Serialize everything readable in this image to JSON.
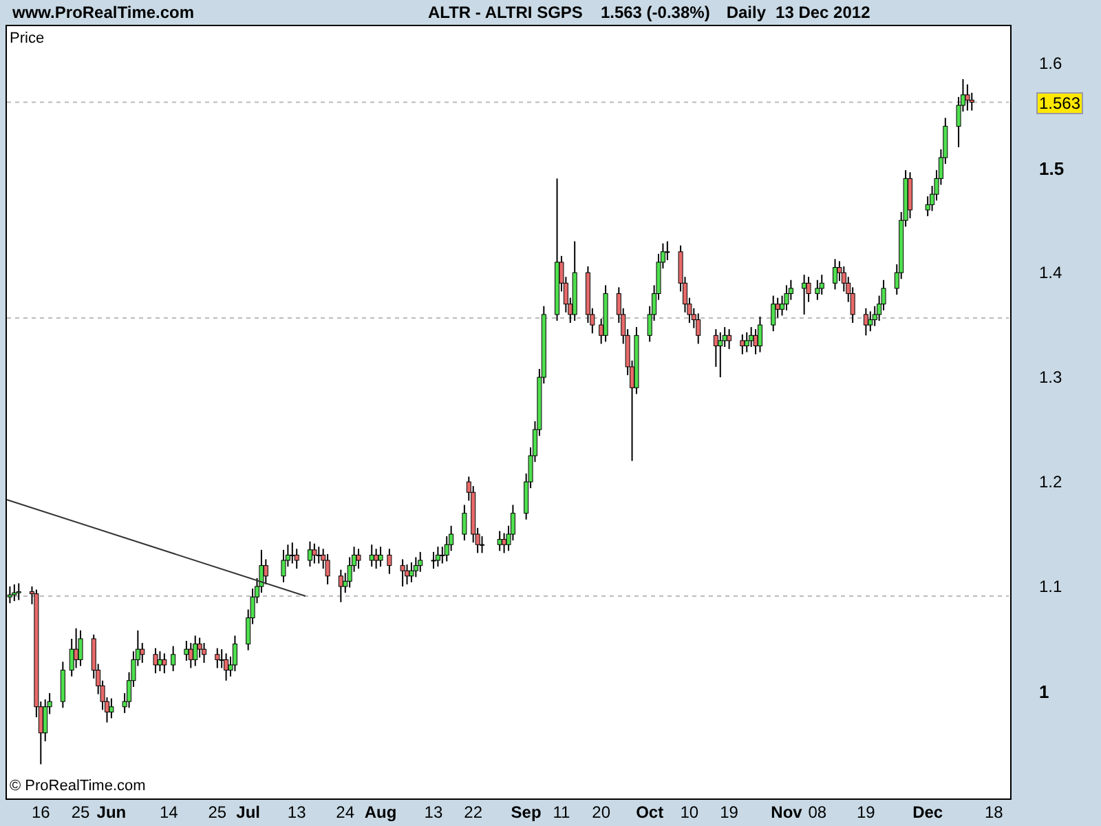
{
  "header": {
    "site": "www.ProRealTime.com",
    "instrument": "ALTR - ALTRI SGPS",
    "quote": "1.563 (-0.38%)",
    "period": "Daily",
    "date": "13 Dec 2012"
  },
  "chart": {
    "panel_label": "Price",
    "copyright": "© ProRealTime.com",
    "last_price": "1.563",
    "chart_data": {
      "type": "candlestick",
      "xlim": [
        "2012-05-08",
        "2012-12-22"
      ],
      "ylim": [
        0.896,
        1.637
      ],
      "yticks": [
        {
          "value": 1.6,
          "label": "1.6"
        },
        {
          "value": 1.5,
          "label": "1.5"
        },
        {
          "value": 1.4,
          "label": "1.4"
        },
        {
          "value": 1.3,
          "label": "1.3"
        },
        {
          "value": 1.2,
          "label": "1.2"
        },
        {
          "value": 1.1,
          "label": "1.1"
        },
        {
          "value": 1,
          "label": "1"
        }
      ],
      "xticks": [
        {
          "value": "2012-05-16",
          "label": "16"
        },
        {
          "value": "2012-05-25",
          "label": "25"
        },
        {
          "value": "2012-06-01",
          "label": "Jun"
        },
        {
          "value": "2012-06-14",
          "label": "14"
        },
        {
          "value": "2012-06-25",
          "label": "25"
        },
        {
          "value": "2012-07-02",
          "label": "Jul"
        },
        {
          "value": "2012-07-13",
          "label": "13"
        },
        {
          "value": "2012-07-24",
          "label": "24"
        },
        {
          "value": "2012-08-01",
          "label": "Aug"
        },
        {
          "value": "2012-08-13",
          "label": "13"
        },
        {
          "value": "2012-08-22",
          "label": "22"
        },
        {
          "value": "2012-09-03",
          "label": "Sep"
        },
        {
          "value": "2012-09-11",
          "label": "11"
        },
        {
          "value": "2012-09-20",
          "label": "20"
        },
        {
          "value": "2012-10-01",
          "label": "Oct"
        },
        {
          "value": "2012-10-10",
          "label": "10"
        },
        {
          "value": "2012-10-19",
          "label": "19"
        },
        {
          "value": "2012-11-01",
          "label": "Nov"
        },
        {
          "value": "2012-11-08",
          "label": "08"
        },
        {
          "value": "2012-11-19",
          "label": "19"
        },
        {
          "value": "2012-12-03",
          "label": "Dec"
        },
        {
          "value": "2012-12-18",
          "label": "18"
        }
      ],
      "x": [
        "2012-05-09",
        "2012-05-10",
        "2012-05-11",
        "2012-05-14",
        "2012-05-15",
        "2012-05-16",
        "2012-05-17",
        "2012-05-18",
        "2012-05-21",
        "2012-05-23",
        "2012-05-24",
        "2012-05-25",
        "2012-05-28",
        "2012-05-29",
        "2012-05-30",
        "2012-05-31",
        "2012-06-01",
        "2012-06-04",
        "2012-06-05",
        "2012-06-06",
        "2012-06-07",
        "2012-06-08",
        "2012-06-11",
        "2012-06-12",
        "2012-06-13",
        "2012-06-15",
        "2012-06-18",
        "2012-06-19",
        "2012-06-20",
        "2012-06-21",
        "2012-06-22",
        "2012-06-25",
        "2012-06-26",
        "2012-06-27",
        "2012-06-28",
        "2012-06-29",
        "2012-07-02",
        "2012-07-03",
        "2012-07-04",
        "2012-07-05",
        "2012-07-06",
        "2012-07-10",
        "2012-07-11",
        "2012-07-12",
        "2012-07-13",
        "2012-07-16",
        "2012-07-17",
        "2012-07-18",
        "2012-07-19",
        "2012-07-20",
        "2012-07-23",
        "2012-07-24",
        "2012-07-25",
        "2012-07-26",
        "2012-07-27",
        "2012-07-30",
        "2012-07-31",
        "2012-08-01",
        "2012-08-03",
        "2012-08-06",
        "2012-08-07",
        "2012-08-08",
        "2012-08-09",
        "2012-08-10",
        "2012-08-13",
        "2012-08-14",
        "2012-08-15",
        "2012-08-16",
        "2012-08-17",
        "2012-08-20",
        "2012-08-21",
        "2012-08-22",
        "2012-08-23",
        "2012-08-24",
        "2012-08-28",
        "2012-08-29",
        "2012-08-30",
        "2012-08-31",
        "2012-09-03",
        "2012-09-04",
        "2012-09-05",
        "2012-09-06",
        "2012-09-07",
        "2012-09-10",
        "2012-09-11",
        "2012-09-12",
        "2012-09-13",
        "2012-09-14",
        "2012-09-17",
        "2012-09-18",
        "2012-09-20",
        "2012-09-21",
        "2012-09-24",
        "2012-09-25",
        "2012-09-26",
        "2012-09-27",
        "2012-09-28",
        "2012-10-01",
        "2012-10-02",
        "2012-10-03",
        "2012-10-04",
        "2012-10-05",
        "2012-10-08",
        "2012-10-09",
        "2012-10-10",
        "2012-10-11",
        "2012-10-12",
        "2012-10-16",
        "2012-10-17",
        "2012-10-18",
        "2012-10-19",
        "2012-10-22",
        "2012-10-23",
        "2012-10-24",
        "2012-10-25",
        "2012-10-26",
        "2012-10-29",
        "2012-10-30",
        "2012-10-31",
        "2012-11-01",
        "2012-11-02",
        "2012-11-05",
        "2012-11-06",
        "2012-11-08",
        "2012-11-09",
        "2012-11-12",
        "2012-11-13",
        "2012-11-14",
        "2012-11-15",
        "2012-11-16",
        "2012-11-19",
        "2012-11-20",
        "2012-11-21",
        "2012-11-22",
        "2012-11-23",
        "2012-11-26",
        "2012-11-27",
        "2012-11-28",
        "2012-11-29",
        "2012-12-03",
        "2012-12-04",
        "2012-12-05",
        "2012-12-06",
        "2012-12-07",
        "2012-12-10",
        "2012-12-11",
        "2012-12-12",
        "2012-12-13"
      ],
      "ohlc": [
        [
          1.09,
          1.1,
          1.084,
          1.092
        ],
        [
          1.092,
          1.102,
          1.086,
          1.094
        ],
        [
          1.094,
          1.103,
          1.087,
          1.095
        ],
        [
          1.095,
          1.1,
          1.083,
          1.093
        ],
        [
          1.093,
          1.097,
          0.975,
          0.985
        ],
        [
          0.985,
          0.99,
          0.93,
          0.96
        ],
        [
          0.96,
          0.992,
          0.952,
          0.985
        ],
        [
          0.985,
          0.998,
          0.978,
          0.99
        ],
        [
          0.99,
          1.028,
          0.984,
          1.02
        ],
        [
          1.02,
          1.05,
          1.014,
          1.04
        ],
        [
          1.04,
          1.06,
          1.022,
          1.03
        ],
        [
          1.03,
          1.058,
          1.024,
          1.05
        ],
        [
          1.05,
          1.054,
          1.012,
          1.02
        ],
        [
          1.02,
          1.026,
          0.997,
          1.005
        ],
        [
          1.005,
          1.01,
          0.982,
          0.99
        ],
        [
          0.99,
          0.994,
          0.97,
          0.98
        ],
        [
          0.98,
          0.993,
          0.974,
          0.985
        ],
        [
          0.985,
          0.998,
          0.979,
          0.99
        ],
        [
          0.99,
          1.018,
          0.984,
          1.01
        ],
        [
          1.01,
          1.038,
          1.004,
          1.03
        ],
        [
          1.03,
          1.058,
          1.024,
          1.04
        ],
        [
          1.04,
          1.046,
          1.027,
          1.035
        ],
        [
          1.035,
          1.041,
          1.017,
          1.025
        ],
        [
          1.025,
          1.038,
          1.019,
          1.03
        ],
        [
          1.03,
          1.036,
          1.017,
          1.025
        ],
        [
          1.025,
          1.043,
          1.019,
          1.035
        ],
        [
          1.035,
          1.048,
          1.029,
          1.04
        ],
        [
          1.04,
          1.046,
          1.022,
          1.03
        ],
        [
          1.03,
          1.053,
          1.024,
          1.045
        ],
        [
          1.045,
          1.051,
          1.032,
          1.04
        ],
        [
          1.04,
          1.046,
          1.027,
          1.035
        ],
        [
          1.035,
          1.041,
          1.022,
          1.03
        ],
        [
          1.03,
          1.04,
          1.022,
          1.03
        ],
        [
          1.03,
          1.036,
          1.01,
          1.02
        ],
        [
          1.02,
          1.033,
          1.014,
          1.025
        ],
        [
          1.025,
          1.053,
          1.019,
          1.045
        ],
        [
          1.045,
          1.078,
          1.039,
          1.07
        ],
        [
          1.07,
          1.098,
          1.064,
          1.09
        ],
        [
          1.09,
          1.108,
          1.084,
          1.1
        ],
        [
          1.1,
          1.135,
          1.094,
          1.12
        ],
        [
          1.12,
          1.126,
          1.102,
          1.11
        ],
        [
          1.11,
          1.135,
          1.104,
          1.125
        ],
        [
          1.125,
          1.14,
          1.119,
          1.13
        ],
        [
          1.13,
          1.142,
          1.122,
          1.13
        ],
        [
          1.13,
          1.136,
          1.117,
          1.125
        ],
        [
          1.125,
          1.143,
          1.119,
          1.135
        ],
        [
          1.135,
          1.141,
          1.122,
          1.13
        ],
        [
          1.13,
          1.138,
          1.122,
          1.13
        ],
        [
          1.13,
          1.136,
          1.117,
          1.125
        ],
        [
          1.125,
          1.131,
          1.102,
          1.11
        ],
        [
          1.11,
          1.116,
          1.085,
          1.1
        ],
        [
          1.1,
          1.113,
          1.094,
          1.105
        ],
        [
          1.105,
          1.128,
          1.099,
          1.12
        ],
        [
          1.12,
          1.138,
          1.114,
          1.13
        ],
        [
          1.13,
          1.136,
          1.117,
          1.125
        ],
        [
          1.125,
          1.14,
          1.119,
          1.13
        ],
        [
          1.13,
          1.136,
          1.117,
          1.125
        ],
        [
          1.125,
          1.138,
          1.119,
          1.13
        ],
        [
          1.13,
          1.136,
          1.112,
          1.12
        ],
        [
          1.12,
          1.126,
          1.1,
          1.115
        ],
        [
          1.115,
          1.121,
          1.102,
          1.11
        ],
        [
          1.11,
          1.123,
          1.104,
          1.115
        ],
        [
          1.115,
          1.128,
          1.109,
          1.12
        ],
        [
          1.12,
          1.133,
          1.114,
          1.125
        ],
        [
          1.125,
          1.133,
          1.117,
          1.125
        ],
        [
          1.125,
          1.138,
          1.119,
          1.13
        ],
        [
          1.13,
          1.138,
          1.122,
          1.13
        ],
        [
          1.13,
          1.148,
          1.124,
          1.14
        ],
        [
          1.14,
          1.158,
          1.134,
          1.15
        ],
        [
          1.15,
          1.178,
          1.144,
          1.17
        ],
        [
          1.2,
          1.205,
          1.182,
          1.19
        ],
        [
          1.19,
          1.196,
          1.142,
          1.15
        ],
        [
          1.15,
          1.156,
          1.132,
          1.14
        ],
        [
          1.14,
          1.148,
          1.132,
          1.14
        ],
        [
          1.14,
          1.153,
          1.134,
          1.145
        ],
        [
          1.145,
          1.151,
          1.132,
          1.14
        ],
        [
          1.14,
          1.158,
          1.134,
          1.15
        ],
        [
          1.15,
          1.178,
          1.144,
          1.17
        ],
        [
          1.17,
          1.208,
          1.164,
          1.2
        ],
        [
          1.2,
          1.233,
          1.194,
          1.225
        ],
        [
          1.225,
          1.258,
          1.219,
          1.25
        ],
        [
          1.25,
          1.308,
          1.244,
          1.3
        ],
        [
          1.3,
          1.368,
          1.294,
          1.36
        ],
        [
          1.36,
          1.49,
          1.354,
          1.41
        ],
        [
          1.41,
          1.416,
          1.382,
          1.39
        ],
        [
          1.39,
          1.396,
          1.362,
          1.37
        ],
        [
          1.37,
          1.376,
          1.352,
          1.36
        ],
        [
          1.36,
          1.43,
          1.354,
          1.4
        ],
        [
          1.4,
          1.406,
          1.352,
          1.36
        ],
        [
          1.36,
          1.366,
          1.342,
          1.35
        ],
        [
          1.35,
          1.356,
          1.332,
          1.34
        ],
        [
          1.34,
          1.388,
          1.334,
          1.38
        ],
        [
          1.38,
          1.386,
          1.352,
          1.36
        ],
        [
          1.36,
          1.366,
          1.332,
          1.34
        ],
        [
          1.34,
          1.346,
          1.302,
          1.31
        ],
        [
          1.31,
          1.316,
          1.22,
          1.29
        ],
        [
          1.29,
          1.348,
          1.284,
          1.34
        ],
        [
          1.34,
          1.368,
          1.334,
          1.36
        ],
        [
          1.36,
          1.388,
          1.354,
          1.38
        ],
        [
          1.38,
          1.418,
          1.374,
          1.41
        ],
        [
          1.41,
          1.428,
          1.404,
          1.42
        ],
        [
          1.42,
          1.43,
          1.412,
          1.42
        ],
        [
          1.42,
          1.426,
          1.382,
          1.39
        ],
        [
          1.39,
          1.396,
          1.362,
          1.37
        ],
        [
          1.37,
          1.376,
          1.352,
          1.36
        ],
        [
          1.36,
          1.366,
          1.347,
          1.355
        ],
        [
          1.355,
          1.361,
          1.332,
          1.34
        ],
        [
          1.34,
          1.346,
          1.31,
          1.33
        ],
        [
          1.33,
          1.343,
          1.3,
          1.335
        ],
        [
          1.335,
          1.348,
          1.329,
          1.34
        ],
        [
          1.34,
          1.346,
          1.327,
          1.335
        ],
        [
          1.335,
          1.341,
          1.322,
          1.33
        ],
        [
          1.33,
          1.343,
          1.324,
          1.335
        ],
        [
          1.335,
          1.348,
          1.329,
          1.34
        ],
        [
          1.34,
          1.346,
          1.322,
          1.33
        ],
        [
          1.33,
          1.358,
          1.324,
          1.35
        ],
        [
          1.35,
          1.378,
          1.344,
          1.37
        ],
        [
          1.37,
          1.376,
          1.357,
          1.365
        ],
        [
          1.365,
          1.378,
          1.359,
          1.37
        ],
        [
          1.37,
          1.388,
          1.364,
          1.38
        ],
        [
          1.38,
          1.393,
          1.374,
          1.385
        ],
        [
          1.385,
          1.398,
          1.36,
          1.39
        ],
        [
          1.39,
          1.396,
          1.372,
          1.38
        ],
        [
          1.38,
          1.393,
          1.374,
          1.385
        ],
        [
          1.385,
          1.398,
          1.379,
          1.39
        ],
        [
          1.39,
          1.413,
          1.384,
          1.405
        ],
        [
          1.405,
          1.411,
          1.392,
          1.4
        ],
        [
          1.4,
          1.406,
          1.382,
          1.39
        ],
        [
          1.39,
          1.396,
          1.372,
          1.38
        ],
        [
          1.38,
          1.386,
          1.352,
          1.36
        ],
        [
          1.36,
          1.366,
          1.34,
          1.35
        ],
        [
          1.35,
          1.363,
          1.344,
          1.355
        ],
        [
          1.355,
          1.368,
          1.349,
          1.36
        ],
        [
          1.36,
          1.378,
          1.354,
          1.37
        ],
        [
          1.37,
          1.393,
          1.364,
          1.385
        ],
        [
          1.385,
          1.408,
          1.379,
          1.4
        ],
        [
          1.4,
          1.458,
          1.394,
          1.45
        ],
        [
          1.45,
          1.498,
          1.444,
          1.49
        ],
        [
          1.49,
          1.496,
          1.452,
          1.46
        ],
        [
          1.46,
          1.473,
          1.454,
          1.465
        ],
        [
          1.465,
          1.483,
          1.459,
          1.475
        ],
        [
          1.475,
          1.498,
          1.469,
          1.49
        ],
        [
          1.49,
          1.518,
          1.484,
          1.51
        ],
        [
          1.51,
          1.548,
          1.504,
          1.54
        ],
        [
          1.54,
          1.568,
          1.52,
          1.56
        ],
        [
          1.56,
          1.585,
          1.554,
          1.57
        ],
        [
          1.57,
          1.58,
          1.555,
          1.565
        ],
        [
          1.565,
          1.572,
          1.555,
          1.563
        ]
      ]
    }
  }
}
